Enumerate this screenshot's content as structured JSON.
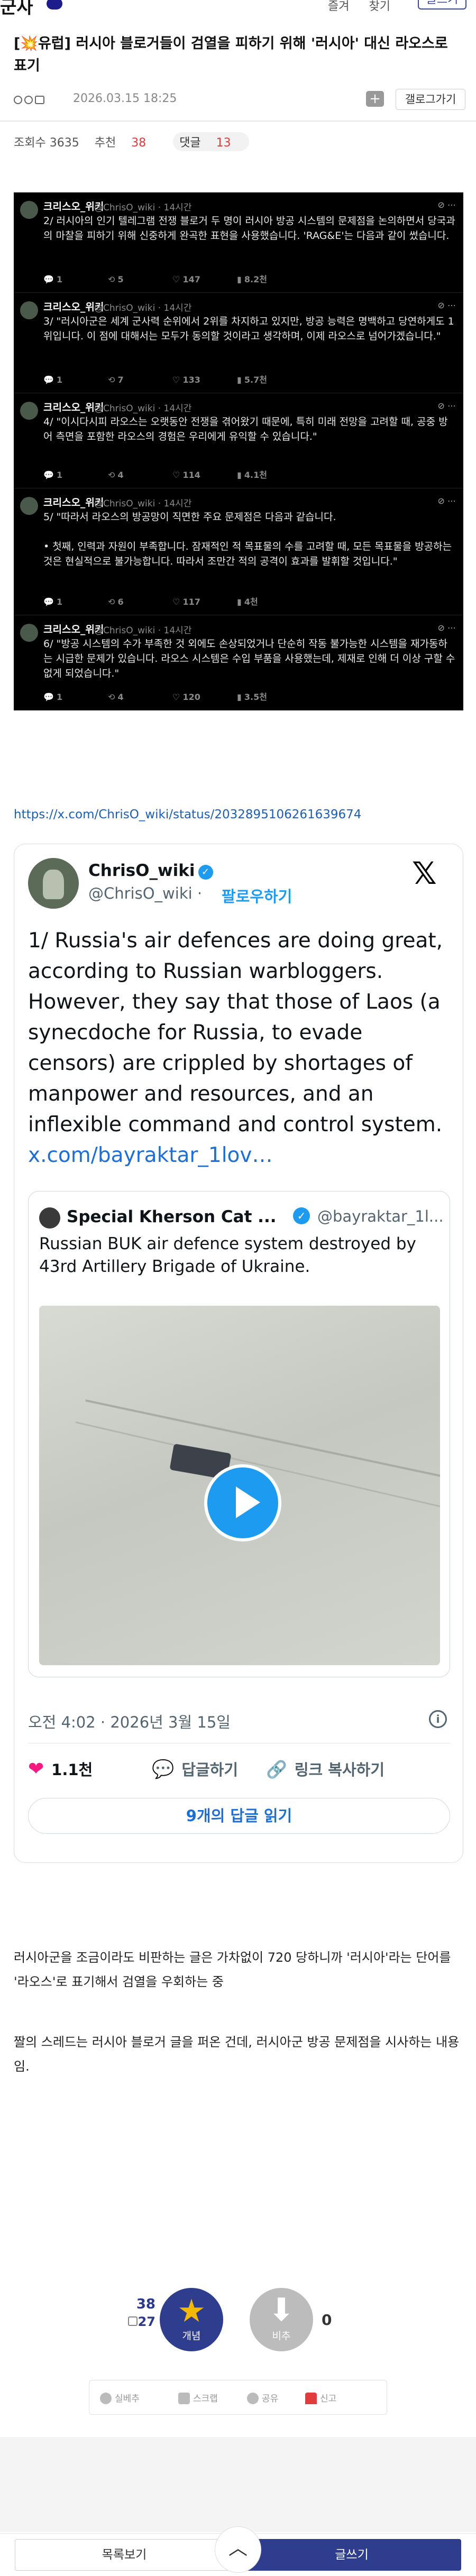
{
  "header": {
    "brand": "군사",
    "links": [
      "즐겨",
      "찾기"
    ],
    "top_button": "글쓰기"
  },
  "post": {
    "title": "[💥유럽] 러시아 블로거들이 검열을 피하기 위해 '러시아' 대신 라오스로 표기",
    "date": "2026.03.15 18:25",
    "gallery_button": "갤로그가기",
    "views_label": "조회수 3635",
    "recommend_label": "추천",
    "recommend_count": "38",
    "comments_label": "댓글",
    "comments_count": "13"
  },
  "dark_posts": [
    {
      "name": "크리스오_위키",
      "handle": "@ChrisO_wiki · 14시간",
      "text": "2/ 러시아의 인기 텔레그램 전쟁 블로거 두 명이 러시아 방공 시스템의 문제점을 논의하면서 당국과의 마찰을 피하기 위해 신중하게 완곡한 표현을 사용했습니다. 'RAG&E'는 다음과 같이 썼습니다.",
      "a1": "1",
      "a2": "5",
      "a3": "147",
      "a4": "8.2천"
    },
    {
      "name": "크리스오_위키",
      "handle": "@ChrisO_wiki · 14시간",
      "text": "3/ \"러시아군은 세계 군사력 순위에서 2위를 차지하고 있지만, 방공 능력은 명백하고 당연하게도 1위입니다. 이 점에 대해서는 모두가 동의할 것이라고 생각하며, 이제 라오스로 넘어가겠습니다.\"",
      "a1": "1",
      "a2": "7",
      "a3": "133",
      "a4": "5.7천"
    },
    {
      "name": "크리스오_위키",
      "handle": "@ChrisO_wiki · 14시간",
      "text": "4/ \"이시다시피 라오스는 오랫동안 전쟁을 겪어왔기 때문에, 특히 미래 전망을 고려할 때, 공중 방어 측면을 포함한 라오스의 경험은 우리에게 유익할 수 있습니다.\"",
      "a1": "1",
      "a2": "4",
      "a3": "114",
      "a4": "4.1천"
    },
    {
      "name": "크리스오_위키",
      "handle": "@ChrisO_wiki · 14시간",
      "text": "5/ \"따라서 라오스의 방공망이 직면한 주요 문제점은 다음과 같습니다.\n\n• 첫째, 인력과 자원이 부족합니다. 잠재적인 적 목표물의 수를 고려할 때, 모든 목표물을 방공하는 것은 현실적으로 불가능합니다. 따라서 조만간 적의 공격이 효과를 발휘할 것입니다.\"",
      "a1": "1",
      "a2": "6",
      "a3": "117",
      "a4": "4천"
    },
    {
      "name": "크리스오_위키",
      "handle": "@ChrisO_wiki · 14시간",
      "text": "6/ \"방공 시스템의 수가 부족한 것 외에도 손상되었거나 단순히 작동 불가능한 시스템을 재가동하는 시급한 문제가 있습니다. 라오스 시스템은 수입 부품을 사용했는데, 제재로 인해 더 이상 구할 수 없게 되었습니다.\"",
      "a1": "1",
      "a2": "4",
      "a3": "120",
      "a4": "3.5천"
    }
  ],
  "source_link": "https://x.com/ChrisO_wiki/status/2032895106261639674",
  "tweet": {
    "name": "ChrisO_wiki",
    "handle": "@ChrisO_wiki",
    "follow": "팔로우하기",
    "body": "1/ Russia's air defences are doing great, according to Russian warbloggers. However, they say that those of Laos (a synecdoche for Russia, to evade censors) are crippled by shortages of manpower and resources, and an inflexible command and control system.",
    "body_link": "x.com/bayraktar_1lov…",
    "quote_name": "Special Kherson Cat ...",
    "quote_handle": "@bayraktar_1l...",
    "quote_text": "Russian BUK air defence system destroyed by 43rd Artillery Brigade of Ukraine.",
    "time": "오전 4:02 · 2026년 3월 15일",
    "likes": "1.1천",
    "reply_label": "답글하기",
    "copy_label": "링크 복사하기",
    "read_replies": "9개의 답글 읽기"
  },
  "paragraphs": {
    "p1": "러시아군을 조금이라도 비판하는 글은 가차없이 720 당하니까 '러시아'라는 단어를 '라오스'로 표기해서 검열을 우회하는 중",
    "p2": "짤의 스레드는 러시아 블로거 글을 퍼온 건데, 러시아군 방공 문제점을 시사하는 내용임."
  },
  "vote": {
    "up_count": "38",
    "fix_count": "27",
    "up_label": "개념",
    "down_label": "비추",
    "down_count": "0"
  },
  "shares": [
    "실베추",
    "스크랩",
    "공유",
    "신고"
  ],
  "bottom": {
    "list": "목록보기",
    "write": "글쓰기"
  },
  "colors": {
    "accent": "#2f3d8f",
    "link": "#1a5fb4",
    "twitter_blue": "#1d9bf0",
    "like_pink": "#f91880"
  }
}
